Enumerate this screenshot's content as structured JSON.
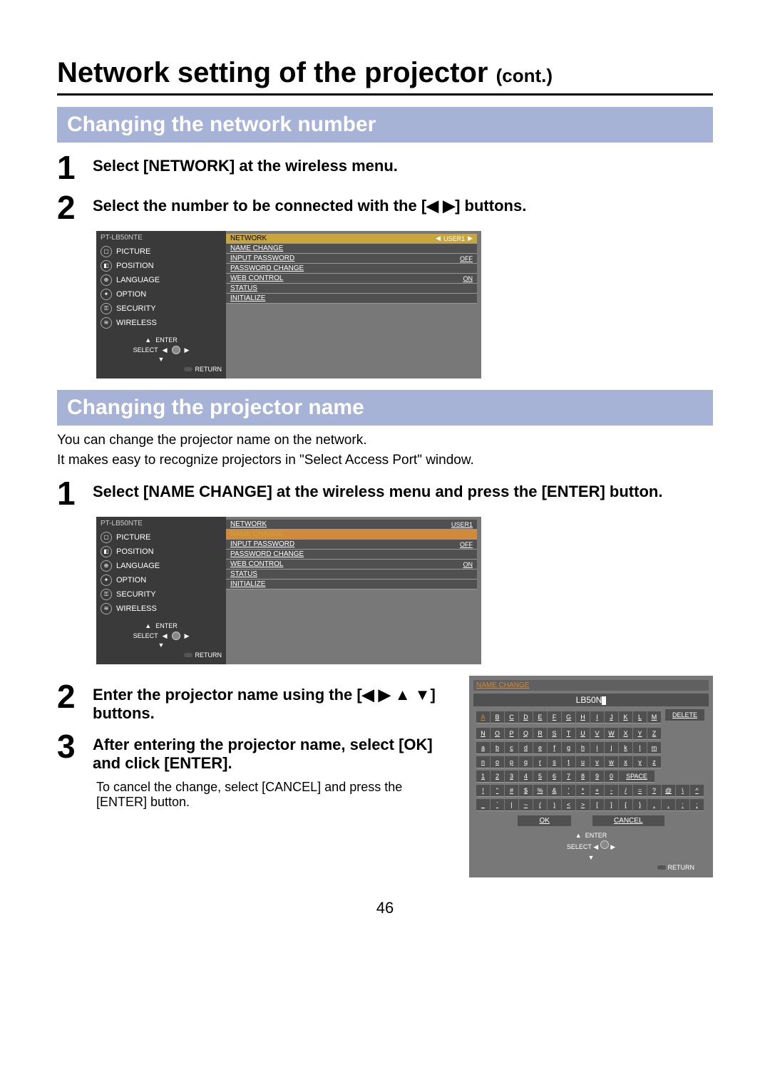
{
  "title_main": "Network setting of the projector",
  "title_cont": "(cont.)",
  "section1": "Changing the network number",
  "s1_step1": "Select [NETWORK] at the wireless menu.",
  "s1_step2": "Select the number to be connected with the [◀ ▶] buttons.",
  "section2": "Changing the projector name",
  "s2_intro1": "You can change the projector name on the network.",
  "s2_intro2": "It makes easy to recognize projectors in \"Select Access Port\" window.",
  "s2_step1": "Select [NAME CHANGE] at the wireless menu and press the [ENTER] button.",
  "s2_step2": "Enter the projector name using the [◀ ▶ ▲ ▼] buttons.",
  "s2_step3": "After entering the projector name, select [OK] and click [ENTER].",
  "s2_note": "To cancel the change, select [CANCEL] and press the [ENTER] button.",
  "page_number": "46",
  "osd": {
    "model": "PT-LB50NTE",
    "menu": [
      "PICTURE",
      "POSITION",
      "LANGUAGE",
      "OPTION",
      "SECURITY",
      "WIRELESS"
    ],
    "nav_enter": "ENTER",
    "nav_select": "SELECT",
    "nav_return": "RETURN",
    "rows": {
      "network": "NETWORK",
      "network_val": "USER1",
      "name_change": "NAME CHANGE",
      "input_password": "INPUT PASSWORD",
      "input_password_val": "OFF",
      "password_change": "PASSWORD CHANGE",
      "web_control": "WEB CONTROL",
      "web_control_val": "ON",
      "status": "STATUS",
      "initialize": "INITIALIZE"
    }
  },
  "kbd": {
    "title": "NAME CHANGE",
    "current": "LB50N",
    "row1": [
      "A",
      "B",
      "C",
      "D",
      "E",
      "F",
      "G",
      "H",
      "I",
      "J",
      "K",
      "L",
      "M"
    ],
    "row2": [
      "N",
      "O",
      "P",
      "Q",
      "R",
      "S",
      "T",
      "U",
      "V",
      "W",
      "X",
      "Y",
      "Z"
    ],
    "row3": [
      "a",
      "b",
      "c",
      "d",
      "e",
      "f",
      "g",
      "h",
      "i",
      "j",
      "k",
      "l",
      "m"
    ],
    "row4": [
      "n",
      "o",
      "p",
      "q",
      "r",
      "s",
      "t",
      "u",
      "v",
      "w",
      "x",
      "y",
      "z"
    ],
    "row5": [
      "1",
      "2",
      "3",
      "4",
      "5",
      "6",
      "7",
      "8",
      "9",
      "0"
    ],
    "row5_space": "SPACE",
    "row6": [
      "!",
      "\"",
      "#",
      "$",
      "%",
      "&",
      "'",
      "*",
      "+",
      "-",
      "/",
      "=",
      "?",
      "@",
      "\\",
      "^"
    ],
    "row7": [
      "_",
      "`",
      "|",
      "~",
      "(",
      ")",
      "<",
      ">",
      "[",
      "]",
      "{",
      "}",
      ",",
      ".",
      ":",
      ";"
    ],
    "delete": "DELETE",
    "ok": "OK",
    "cancel": "CANCEL",
    "enter": "ENTER",
    "select": "SELECT",
    "return": "RETURN"
  }
}
